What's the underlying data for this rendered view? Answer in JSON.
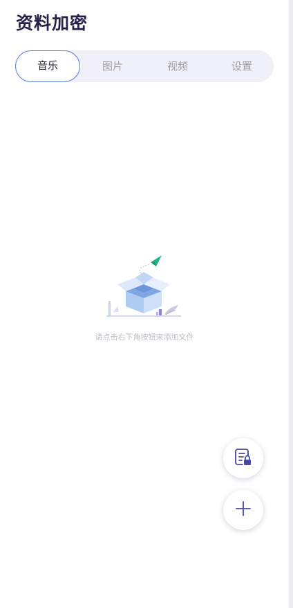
{
  "app": {
    "title": "资料加密"
  },
  "tabs": [
    {
      "label": "音乐",
      "active": true
    },
    {
      "label": "图片",
      "active": false
    },
    {
      "label": "视频",
      "active": false
    },
    {
      "label": "设置",
      "active": false
    }
  ],
  "empty_state": {
    "illustration_icon": "empty-box-paper-plane-icon",
    "message": "请点击右下角按钮来添加文件"
  },
  "fabs": {
    "encrypted_files_icon": "document-lock-icon",
    "add_icon": "plus-icon"
  },
  "colors": {
    "title": "#23234a",
    "tab_track": "#f0f0fa",
    "tab_active_border": "#5c82d8",
    "tab_inactive_text": "#9d9dab",
    "accent_icon": "#4a47a8",
    "plane": "#1db48a"
  }
}
